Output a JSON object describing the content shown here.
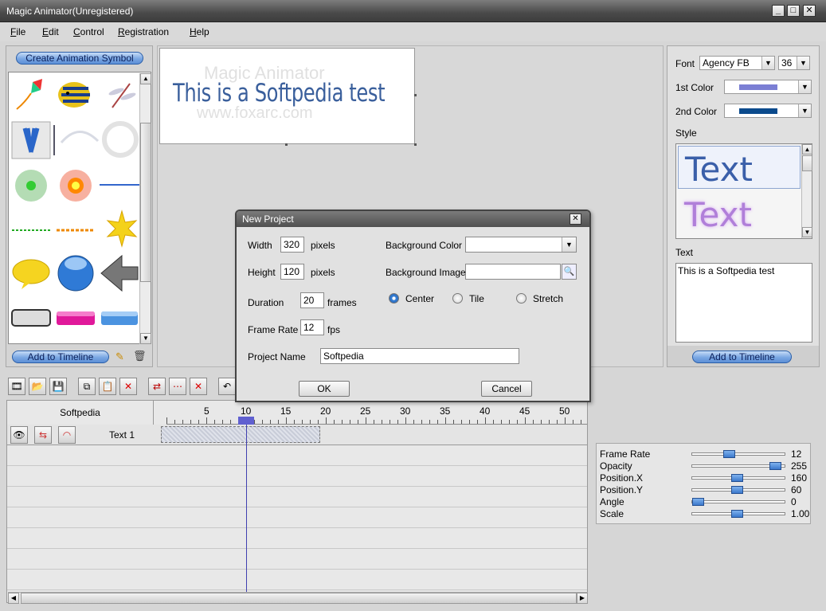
{
  "window": {
    "title": "Magic Animator(Unregistered)"
  },
  "menu": [
    "File",
    "Edit",
    "Control",
    "Registration",
    "Help"
  ],
  "library": {
    "create_button": "Create Animation Symbol",
    "add_button": "Add to Timeline",
    "symbols": [
      "kite-icon",
      "fish-icon",
      "dragonfly-icon",
      "butterfly-icon",
      "divider-icon",
      "arc-icon",
      "glow-ring-icon",
      "green-glow-icon",
      "red-glow-icon",
      "blue-line-icon",
      "green-line-icon",
      "orange-line-icon",
      "star-burst-icon",
      "speech-bubble-icon",
      "blue-orb-icon",
      "left-arrow-icon",
      "gray-button-icon",
      "pink-button-icon",
      "blue-button-icon"
    ]
  },
  "stage": {
    "text": "This is a Softpedia test",
    "watermark_line1": "Magic Animator",
    "watermark_line2": "www.foxarc.com"
  },
  "properties": {
    "font_label": "Font",
    "font_value": "Agency FB",
    "size_value": "36",
    "color1_label": "1st Color",
    "color1": "#7b7fd4",
    "color2_label": "2nd Color",
    "color2": "#0b4a8c",
    "style_label": "Style",
    "style_sample": "Text",
    "text_label": "Text",
    "text_value": "This is a Softpedia test",
    "add_button": "Add to Timeline"
  },
  "dialog": {
    "title": "New Project",
    "width_label": "Width",
    "width_value": "320",
    "width_unit": "pixels",
    "height_label": "Height",
    "height_value": "120",
    "height_unit": "pixels",
    "duration_label": "Duration",
    "duration_value": "20",
    "duration_unit": "frames",
    "framerate_label": "Frame Rate",
    "framerate_value": "12",
    "framerate_unit": "fps",
    "bgcolor_label": "Background Color",
    "bgimage_label": "Background Image",
    "radio_center": "Center",
    "radio_tile": "Tile",
    "radio_stretch": "Stretch",
    "projname_label": "Project Name",
    "projname_value": "Softpedia",
    "ok": "OK",
    "cancel": "Cancel"
  },
  "timeline": {
    "project": "Softpedia",
    "layer": "Text 1",
    "ticks": [
      "5",
      "10",
      "15",
      "20",
      "25",
      "30",
      "35",
      "40",
      "45",
      "50"
    ],
    "current_frame": 10,
    "clip_end_frame": 20
  },
  "sliders": [
    {
      "label": "Frame Rate",
      "value": "12",
      "fraction": 0.38
    },
    {
      "label": "Opacity",
      "value": "255",
      "fraction": 0.95
    },
    {
      "label": "Position.X",
      "value": "160",
      "fraction": 0.48
    },
    {
      "label": "Position.Y",
      "value": "60",
      "fraction": 0.48
    },
    {
      "label": "Angle",
      "value": "0",
      "fraction": 0.0
    },
    {
      "label": "Scale",
      "value": "1.00",
      "fraction": 0.48
    }
  ]
}
